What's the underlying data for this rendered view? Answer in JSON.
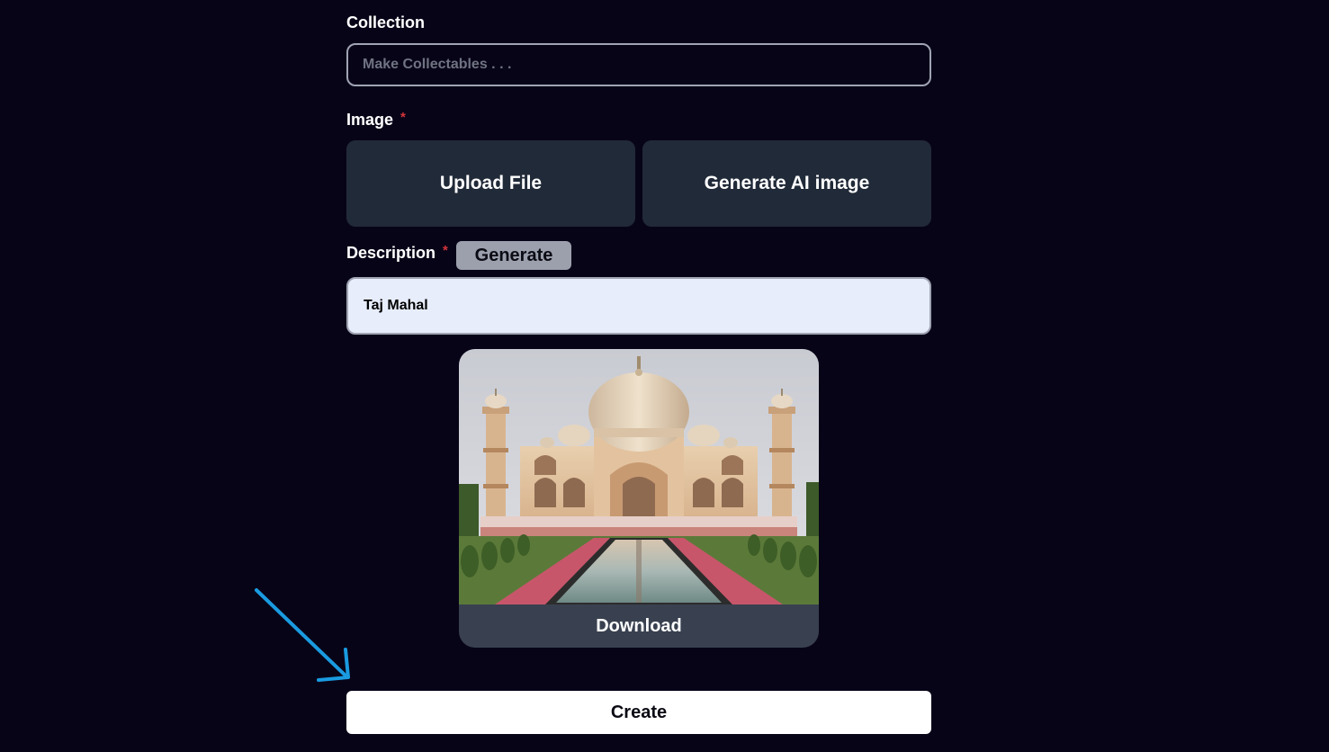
{
  "collection": {
    "label": "Collection",
    "placeholder": "Make Collectables . . .",
    "value": ""
  },
  "image": {
    "label": "Image",
    "required_mark": "*",
    "upload_label": "Upload File",
    "generate_ai_label": "Generate AI image"
  },
  "description": {
    "label": "Description",
    "required_mark": "*",
    "generate_label": "Generate",
    "value": "Taj Mahal"
  },
  "preview": {
    "subject": "taj-mahal-image",
    "download_label": "Download"
  },
  "create_label": "Create",
  "annotation": {
    "arrow_color": "#1a9be0"
  },
  "colors": {
    "background": "#080418",
    "button_dark": "#212a38",
    "card_footer": "#394150",
    "required": "#d4353a"
  }
}
